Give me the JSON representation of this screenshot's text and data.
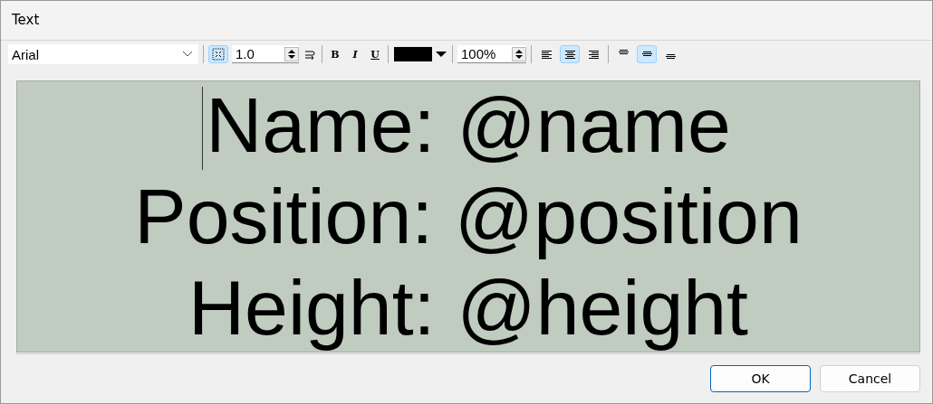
{
  "window": {
    "title": "Text"
  },
  "toolbar": {
    "font": "Arial",
    "fit_to_frame": {
      "selected": true
    },
    "line_spacing": "1.0",
    "bold": "B",
    "italic": "I",
    "underline": "U",
    "color": "#000000",
    "scale": "100%",
    "halign": [
      {
        "kind": "left",
        "selected": false
      },
      {
        "kind": "center",
        "selected": true
      },
      {
        "kind": "right",
        "selected": false
      }
    ],
    "valign": [
      {
        "kind": "top",
        "selected": false
      },
      {
        "kind": "middle",
        "selected": true
      },
      {
        "kind": "bottom",
        "selected": false
      }
    ]
  },
  "editor": {
    "lines": [
      "Name: @name",
      "Position: @position",
      "Height: @height"
    ]
  },
  "buttons": [
    {
      "label": "OK",
      "default": true
    },
    {
      "label": "Cancel",
      "default": false
    }
  ]
}
